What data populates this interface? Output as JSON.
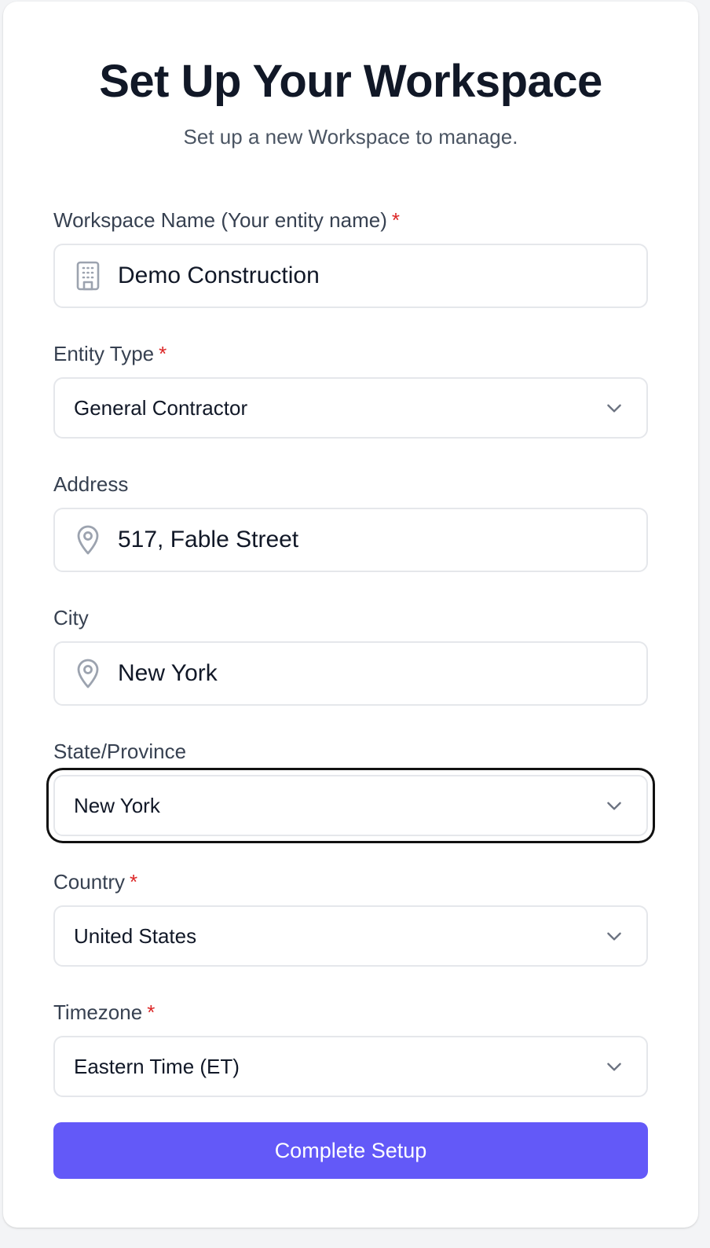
{
  "header": {
    "title": "Set Up Your Workspace",
    "subtitle": "Set up a new Workspace to manage."
  },
  "form": {
    "workspace_name": {
      "label": "Workspace Name (Your entity name)",
      "required_mark": "*",
      "value": "Demo Construction",
      "icon": "building-icon"
    },
    "entity_type": {
      "label": "Entity Type",
      "required_mark": "*",
      "value": "General Contractor"
    },
    "address": {
      "label": "Address",
      "value": "517, Fable Street",
      "icon": "map-pin-icon"
    },
    "city": {
      "label": "City",
      "value": "New York",
      "icon": "map-pin-icon"
    },
    "state": {
      "label": "State/Province",
      "value": "New York",
      "focused": true
    },
    "country": {
      "label": "Country",
      "required_mark": "*",
      "value": "United States"
    },
    "timezone": {
      "label": "Timezone",
      "required_mark": "*",
      "value": "Eastern Time (ET)"
    },
    "submit_label": "Complete Setup"
  },
  "colors": {
    "primary": "#6359f8",
    "required": "#dc2626",
    "title": "#111827",
    "subtitle": "#4b5563",
    "border": "#e5e7eb",
    "focus_ring": "#111111",
    "icon": "#9ca3af"
  }
}
